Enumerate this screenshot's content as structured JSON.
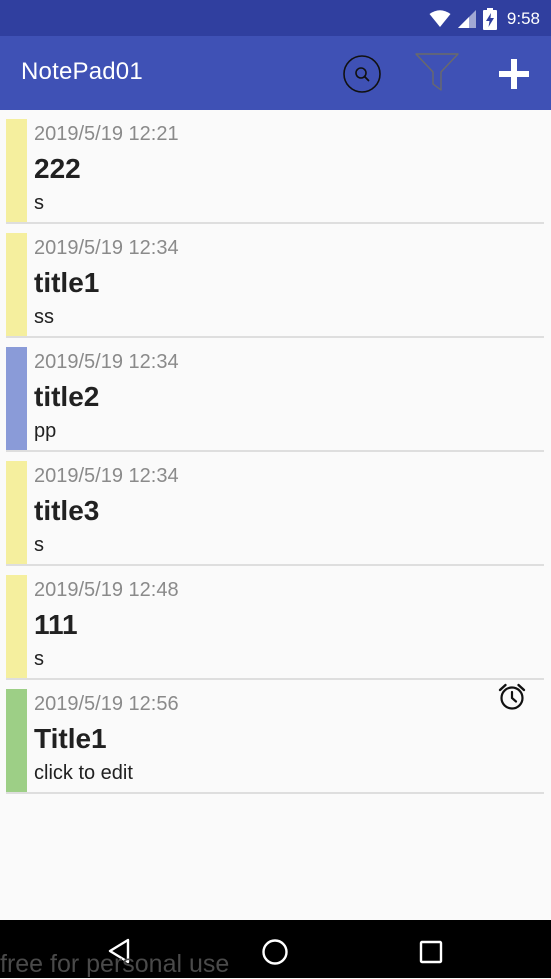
{
  "status_bar": {
    "time": "9:58",
    "icons": [
      "wifi-icon",
      "cell-signal-icon",
      "battery-charging-icon"
    ]
  },
  "app_bar": {
    "title": "NotePad01",
    "actions": [
      "search-icon",
      "filter-icon",
      "add-icon"
    ]
  },
  "notes": [
    {
      "date": "2019/5/19 12:21",
      "title": "222",
      "body": "s",
      "color": "#f5ef9e",
      "alarm": false
    },
    {
      "date": "2019/5/19 12:34",
      "title": "title1",
      "body": "ss",
      "color": "#f5ef9e",
      "alarm": false
    },
    {
      "date": "2019/5/19 12:34",
      "title": "title2",
      "body": "pp",
      "color": "#8a9bd8",
      "alarm": false
    },
    {
      "date": "2019/5/19 12:34",
      "title": "title3",
      "body": "s",
      "color": "#f5ef9e",
      "alarm": false
    },
    {
      "date": "2019/5/19 12:48",
      "title": "111",
      "body": "s",
      "color": "#f5ef9e",
      "alarm": false
    },
    {
      "date": "2019/5/19 12:56",
      "title": "Title1",
      "body": "click to edit",
      "color": "#9dcf86",
      "alarm": true
    }
  ],
  "nav_bar": {
    "buttons": [
      "back-icon",
      "home-icon",
      "recents-icon"
    ]
  },
  "watermark": "free for personal use",
  "colors": {
    "status_bar": "#303f9f",
    "app_bar": "#3f51b5",
    "background": "#fafafa"
  }
}
